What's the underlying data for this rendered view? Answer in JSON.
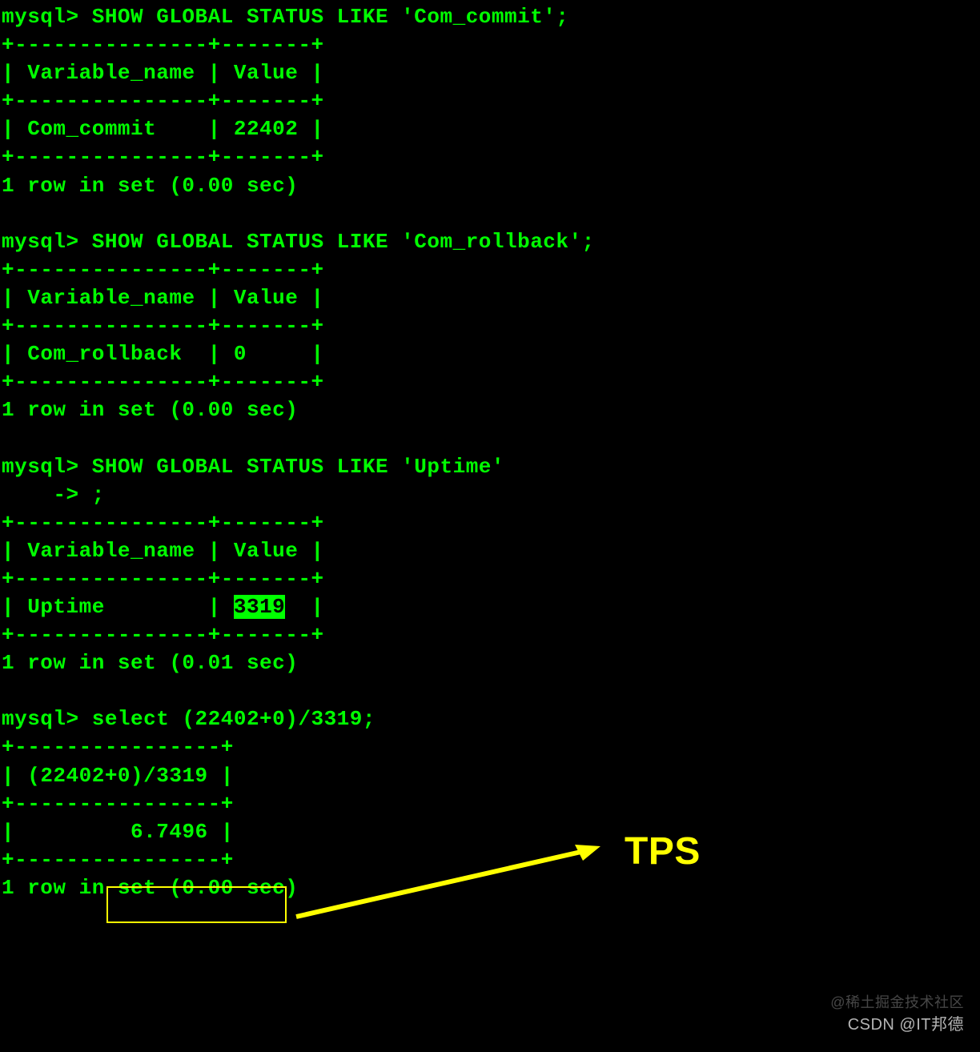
{
  "queries": [
    {
      "prompt": "mysql> ",
      "sql": "SHOW GLOBAL STATUS LIKE 'Com_commit';",
      "cols": [
        "Variable_name",
        "Value"
      ],
      "row": [
        "Com_commit   ",
        "22402"
      ],
      "footer": "1 row in set (0.00 sec)"
    },
    {
      "prompt": "mysql> ",
      "sql": "SHOW GLOBAL STATUS LIKE 'Com_rollback';",
      "cols": [
        "Variable_name",
        "Value"
      ],
      "row": [
        "Com_rollback ",
        "0    "
      ],
      "footer": "1 row in set (0.00 sec)"
    },
    {
      "prompt": "mysql> ",
      "sql": "SHOW GLOBAL STATUS LIKE 'Uptime'",
      "cont": "    -> ;",
      "cols": [
        "Variable_name",
        "Value"
      ],
      "row": [
        "Uptime       ",
        "3319 "
      ],
      "highlight": "3319",
      "footer": "1 row in set (0.01 sec)"
    },
    {
      "prompt": "mysql> ",
      "sql": "select (22402+0)/3319;",
      "cols": [
        "(22402+0)/3319"
      ],
      "row": [
        "        6.7496"
      ],
      "footer": "1 row in set (0.00 sec)"
    }
  ],
  "annotation": {
    "label": "TPS"
  },
  "watermarks": {
    "top": "@稀土掘金技术社区",
    "bottom": "CSDN @IT邦德"
  }
}
